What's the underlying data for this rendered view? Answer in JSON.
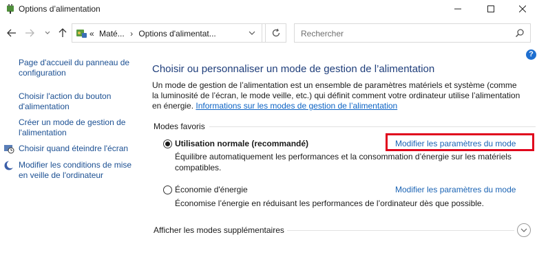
{
  "window": {
    "title": "Options d’alimentation",
    "minimize_icon": "minimize-icon",
    "maximize_icon": "maximize-icon",
    "close_icon": "close-icon"
  },
  "address": {
    "overflow": "«",
    "crumbs": [
      "Maté...",
      "Options d'alimentat..."
    ],
    "search_placeholder": "Rechercher"
  },
  "help": {
    "label": "?"
  },
  "sidebar": {
    "items": [
      {
        "label": "Page d'accueil du panneau de configuration"
      },
      {
        "label": "Choisir l'action du bouton d'alimentation"
      },
      {
        "label": "Créer un mode de gestion de l'alimentation"
      },
      {
        "label": "Choisir quand éteindre l'écran"
      },
      {
        "label": "Modifier les conditions de mise en veille de l'ordinateur"
      }
    ]
  },
  "main": {
    "title": "Choisir ou personnaliser un mode de gestion de l’alimentation",
    "description": "Un mode de gestion de l’alimentation est un ensemble de paramètres matériels et système (comme la luminosité de l’écran, le mode veille, etc.) qui définit comment votre ordinateur utilise l’alimentation en énergie. ",
    "description_link": "Informations sur les modes de gestion de l’alimentation",
    "section_label": "Modes favoris",
    "plans": [
      {
        "name": "Utilisation normale (recommandé)",
        "selected": true,
        "link": "Modifier les paramètres du mode",
        "description": "Équilibre automatiquement les performances et la consommation d’énergie sur les matériels compatibles."
      },
      {
        "name": "Économie d'énergie",
        "selected": false,
        "link": "Modifier les paramètres du mode",
        "description": "Économise l’énergie en réduisant les performances de l’ordinateur dès que possible."
      }
    ],
    "more_label": "Afficher les modes supplémentaires"
  },
  "colors": {
    "link": "#1a63b4",
    "title": "#1e3d7a",
    "highlight": "#e0001b"
  }
}
